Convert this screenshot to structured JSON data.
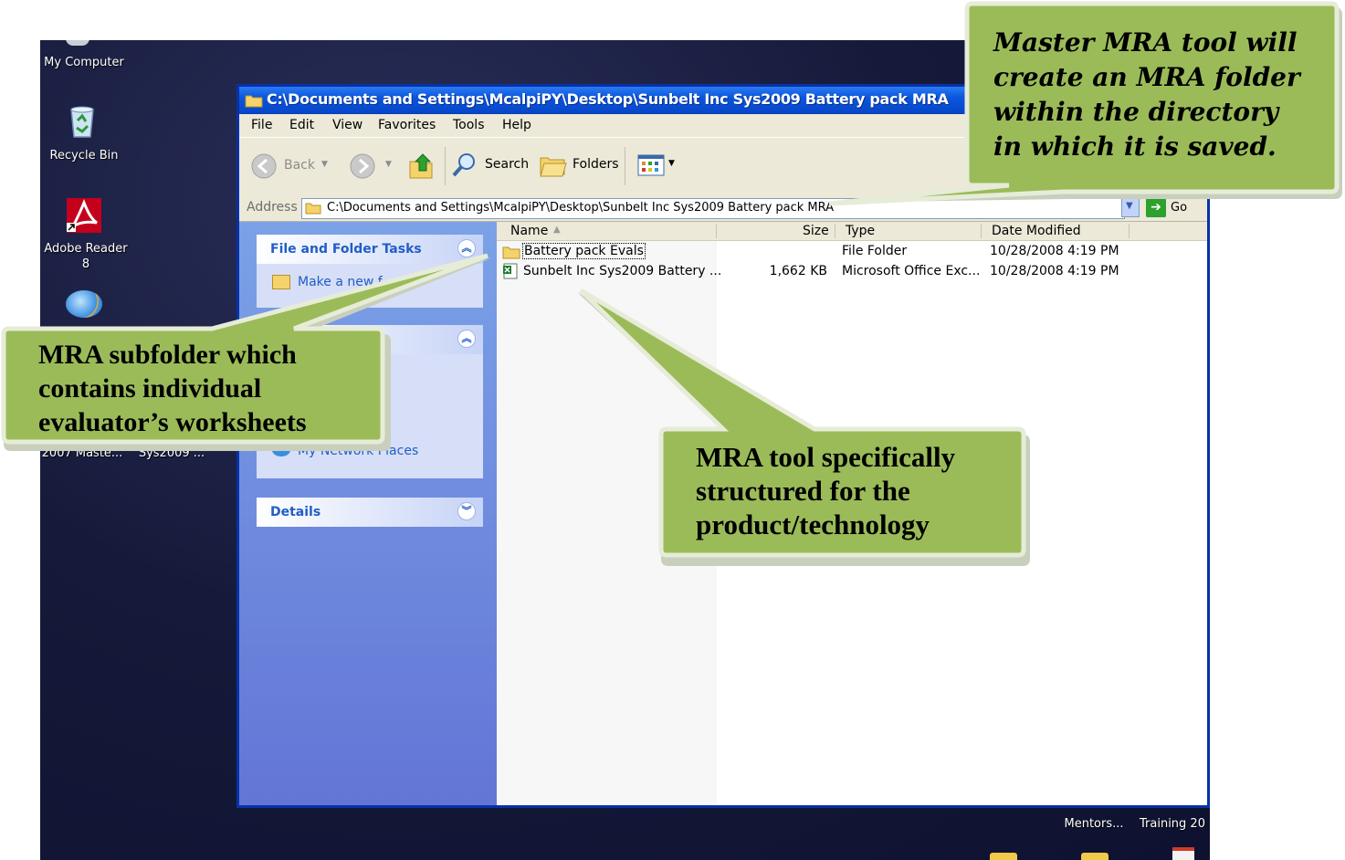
{
  "desktop": {
    "icons": [
      {
        "label": "My Computer"
      },
      {
        "label": "Recycle Bin"
      },
      {
        "label": "Adobe Reader 8"
      }
    ],
    "partial_labels": [
      "2007 Maste...",
      "Sys2009 ..."
    ],
    "bottom_labels": [
      "Mentors...",
      "Training 20"
    ]
  },
  "window": {
    "title": "C:\\Documents and Settings\\McalpiPY\\Desktop\\Sunbelt Inc Sys2009 Battery pack MRA",
    "menu": [
      "File",
      "Edit",
      "View",
      "Favorites",
      "Tools",
      "Help"
    ],
    "toolbar": {
      "back": "Back",
      "search": "Search",
      "folders": "Folders"
    },
    "address": {
      "label": "Address",
      "value": "C:\\Documents and Settings\\McalpiPY\\Desktop\\Sunbelt Inc Sys2009 Battery pack MRA",
      "go": "Go"
    },
    "left_pane": {
      "file_tasks": {
        "title": "File and Folder Tasks",
        "item": "Make a new f"
      },
      "other_places": {
        "item": "My Network Places"
      },
      "details": {
        "title": "Details"
      }
    },
    "columns": [
      "Name",
      "Size",
      "Type",
      "Date Modified"
    ],
    "files": [
      {
        "name": "Battery pack Evals",
        "size": "",
        "type": "File Folder",
        "modified": "10/28/2008 4:19 PM"
      },
      {
        "name": "Sunbelt Inc Sys2009 Battery ...",
        "size": "1,662 KB",
        "type": "Microsoft Office Exc...",
        "modified": "10/28/2008 4:19 PM"
      }
    ]
  },
  "callouts": {
    "top": "Master MRA tool will create an MRA folder within the directory in which it is saved.",
    "left": "MRA subfolder which contains individual evaluator’s worksheets",
    "center": "MRA tool specifically structured for the product/technology"
  },
  "colors": {
    "callout_fill": "#9bbb59",
    "callout_border": "#e6ecd7",
    "window_blue": "#0a4fd6"
  }
}
